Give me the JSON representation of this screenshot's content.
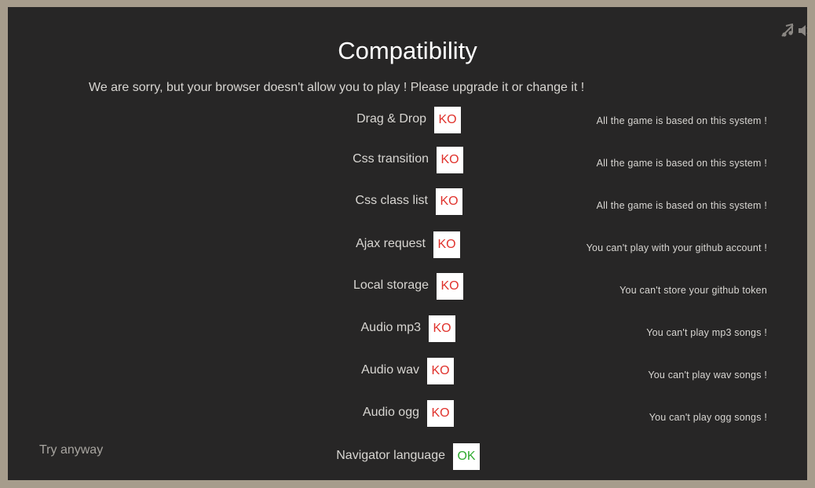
{
  "compatibility": {
    "title": "Compatibility",
    "message": "We are sorry, but your browser doesn't allow you to play ! Please upgrade it or change it !",
    "checks": [
      {
        "feature": "Drag & Drop",
        "status": "KO",
        "note": "All the game is based on this system !"
      },
      {
        "feature": "Css transition",
        "status": "KO",
        "note": "All the game is based on this system !"
      },
      {
        "feature": "Css class list",
        "status": "KO",
        "note": "All the game is based on this system !"
      },
      {
        "feature": "Ajax request",
        "status": "KO",
        "note": "You can't play with your github account !"
      },
      {
        "feature": "Local storage",
        "status": "KO",
        "note": "You can't store your github token"
      },
      {
        "feature": "Audio mp3",
        "status": "KO",
        "note": "You can't play mp3 songs !"
      },
      {
        "feature": "Audio wav",
        "status": "KO",
        "note": "You can't play wav songs !"
      },
      {
        "feature": "Audio ogg",
        "status": "KO",
        "note": "You can't play ogg songs !"
      },
      {
        "feature": "Navigator language",
        "status": "OK",
        "note": ""
      }
    ],
    "try_anyway": "Try anyway"
  },
  "icons": {
    "music_muted": "music-off-icon",
    "sound": "speaker-icon"
  },
  "colors": {
    "background": "#272626",
    "frame": "#a69c8c",
    "ko": "#e0322c",
    "ok": "#2eaa2e"
  }
}
